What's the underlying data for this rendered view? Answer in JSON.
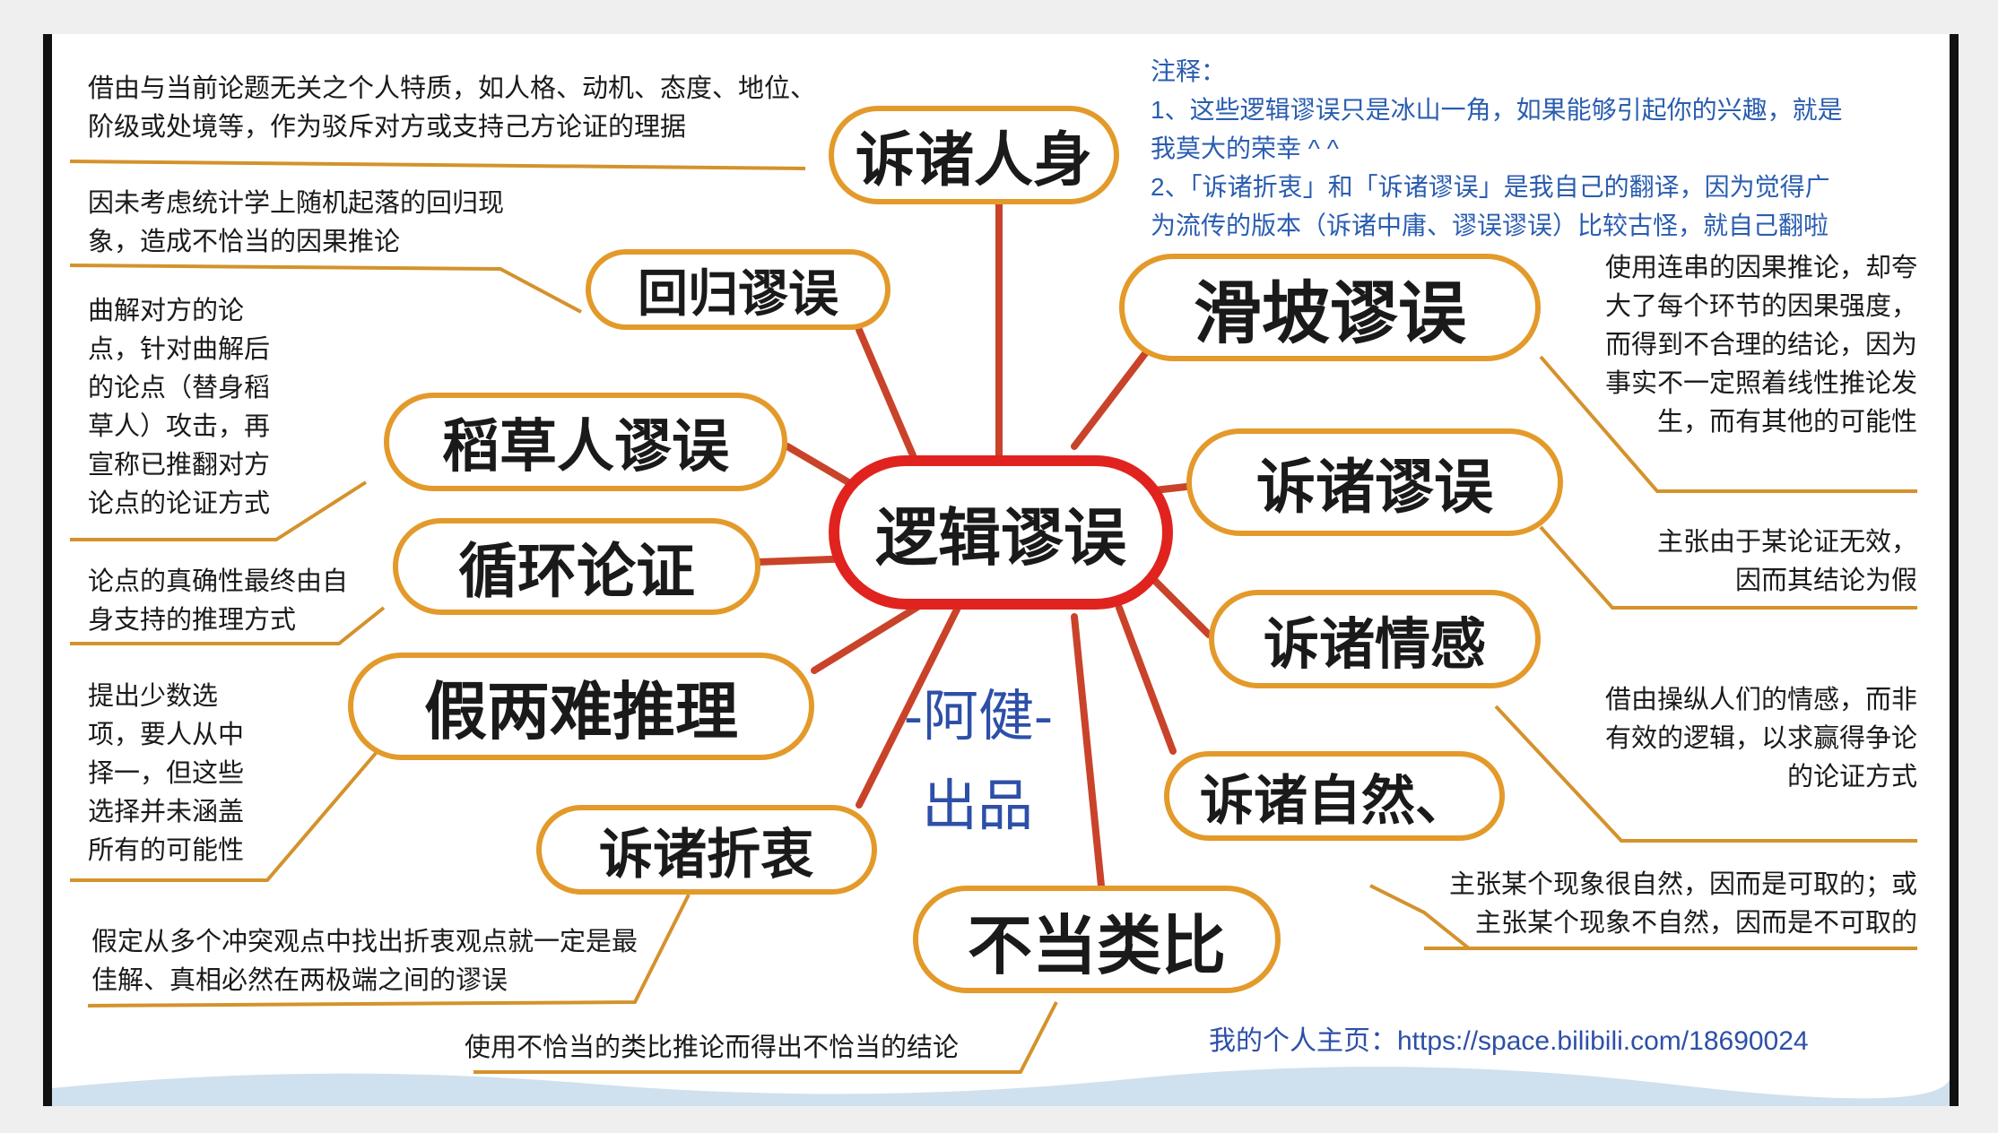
{
  "center": "逻辑谬误",
  "branches": [
    {
      "label": "诉诸人身",
      "desc": "借由与当前论题无关之个人特质，如人格、动机、态度、地位、阶级或处境等，作为驳斥对方或支持己方论证的理据"
    },
    {
      "label": "回归谬误",
      "desc": "因未考虑统计学上随机起落的回归现象，造成不恰当的因果推论"
    },
    {
      "label": "稻草人谬误",
      "desc": "曲解对方的论点，针对曲解后的论点（替身稻草人）攻击，再宣称已推翻对方论点的论证方式"
    },
    {
      "label": "循环论证",
      "desc": "论点的真确性最终由自身支持的推理方式"
    },
    {
      "label": "假两难推理",
      "desc": "提出少数选项，要人从中择一，但这些选择并未涵盖所有的可能性"
    },
    {
      "label": "诉诸折衷",
      "desc": "假定从多个冲突观点中找出折衷观点就一定是最佳解、真相必然在两极端之间的谬误"
    },
    {
      "label": "不当类比",
      "desc": "使用不恰当的类比推论而得出不恰当的结论"
    },
    {
      "label": "诉诸自然、",
      "desc": "主张某个现象很自然，因而是可取的；或主张某个现象不自然，因而是不可取的"
    },
    {
      "label": "诉诸情感",
      "desc": "借由操纵人们的情感，而非有效的逻辑，以求赢得争论的论证方式"
    },
    {
      "label": "诉诸谬误",
      "desc": "主张由于某论证无效，因而其结论为假"
    },
    {
      "label": "滑坡谬误",
      "desc": "使用连串的因果推论，却夸大了每个环节的因果强度，而得到不合理的结论，因为事实不一定照着线性推论发生，而有其他的可能性"
    }
  ],
  "notes": {
    "title": "注释：",
    "line1": "1、这些逻辑谬误只是冰山一角，如果能够引起你的兴趣，就是",
    "line1b": "我莫大的荣幸 ^ ^",
    "line2": "2、「诉诸折衷」和「诉诸谬误」是我自己的翻译，因为觉得广",
    "line2b": "为流传的版本（诉诸中庸、谬误谬误）比较古怪，就自己翻啦"
  },
  "signature": {
    "name": "-阿健-",
    "tag": "出品"
  },
  "homepage": "我的个人主页：https://space.bilibili.com/18690024",
  "colors": {
    "center_border": "#e0231f",
    "node_border": "#e39a2a",
    "connector": "#c9432a",
    "underline": "#d4922c",
    "note": "#2a5db0"
  }
}
